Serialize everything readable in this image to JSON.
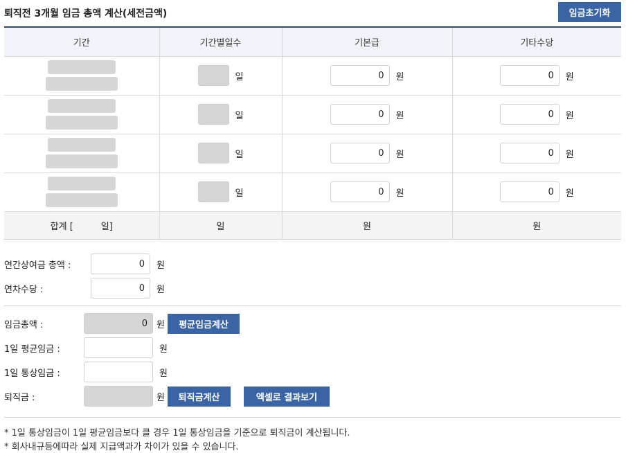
{
  "header": {
    "title": "퇴직전 3개월 임금 총액 계산(세전금액)",
    "reset_button": "임금초기화"
  },
  "table": {
    "columns": [
      "기간",
      "기간별일수",
      "기본급",
      "기타수당"
    ],
    "rows": [
      {
        "basic": "0",
        "other": "0"
      },
      {
        "basic": "0",
        "other": "0"
      },
      {
        "basic": "0",
        "other": "0"
      },
      {
        "basic": "0",
        "other": "0"
      }
    ],
    "unit_day": "일",
    "unit_won": "원",
    "footer": {
      "sum_prefix": "합계 [",
      "sum_suffix": "일]",
      "days_unit": "일",
      "basic_unit": "원",
      "other_unit": "원"
    }
  },
  "extra": {
    "bonus_label": "연간상여금 총액 :",
    "bonus_value": "0",
    "leave_label": "연차수당 :",
    "leave_value": "0",
    "unit_won": "원"
  },
  "calc": {
    "total_label": "임금총액 :",
    "total_value": "0",
    "avg_button": "평균임금계산",
    "avg_label": "1일 평균임금 :",
    "avg_value": "",
    "ordinary_label": "1일 통상임금 :",
    "ordinary_value": "",
    "severance_label": "퇴직금 :",
    "severance_value": "",
    "severance_button": "퇴직금계산",
    "excel_button": "엑셀로 결과보기",
    "unit_won": "원"
  },
  "notes": [
    "* 1일 통상임금이 1일 평균임금보다 클 경우 1일 통상임금을 기준으로 퇴직금이 계산됩니다.",
    "* 회사내규등에따라 실제 지급액과가 차이가 있을 수 있습니다."
  ]
}
